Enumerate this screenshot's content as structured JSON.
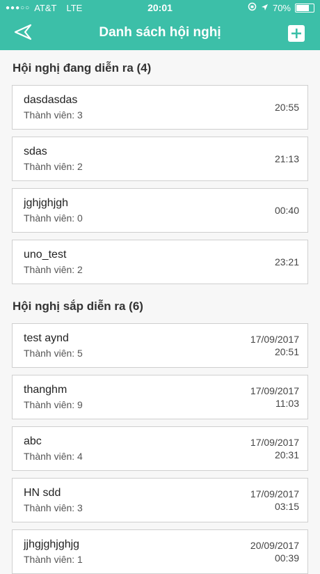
{
  "status": {
    "carrier": "AT&T",
    "network": "LTE",
    "time": "20:01",
    "battery": "70%",
    "signal_dots": "●●●○○"
  },
  "header": {
    "title": "Danh sách hội nghị",
    "color": "#3cbfa8"
  },
  "sections": [
    {
      "title": "Hội nghị đang diễn ra (4)",
      "items": [
        {
          "name": "dasdasdas",
          "members": "Thành viên: 3",
          "date": "",
          "time": "20:55"
        },
        {
          "name": "sdas",
          "members": "Thành viên: 2",
          "date": "",
          "time": "21:13"
        },
        {
          "name": "jghjghjgh",
          "members": "Thành viên: 0",
          "date": "",
          "time": "00:40"
        },
        {
          "name": "uno_test",
          "members": "Thành viên: 2",
          "date": "",
          "time": "23:21"
        }
      ]
    },
    {
      "title": "Hội nghị sắp diễn ra (6)",
      "items": [
        {
          "name": "test aynd",
          "members": "Thành viên: 5",
          "date": "17/09/2017",
          "time": "20:51"
        },
        {
          "name": "thanghm",
          "members": "Thành viên: 9",
          "date": "17/09/2017",
          "time": "11:03"
        },
        {
          "name": "abc",
          "members": "Thành viên: 4",
          "date": "17/09/2017",
          "time": "20:31"
        },
        {
          "name": "HN sdd",
          "members": "Thành viên: 3",
          "date": "17/09/2017",
          "time": "03:15"
        },
        {
          "name": "jjhgjghjghjg",
          "members": "Thành viên: 1",
          "date": "20/09/2017",
          "time": "00:39"
        }
      ]
    }
  ]
}
